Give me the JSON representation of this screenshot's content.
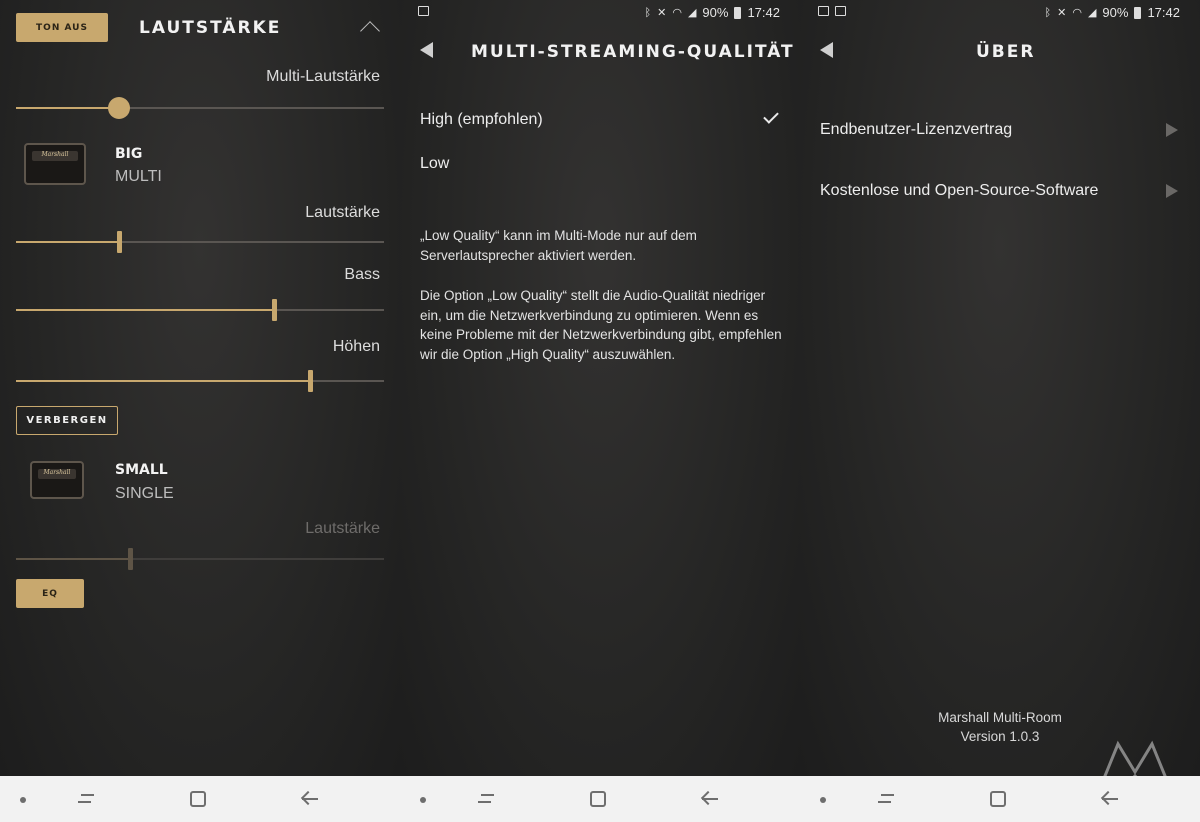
{
  "status_bar": {
    "battery": "90%",
    "time": "17:42"
  },
  "screen1": {
    "mute_button": "TON AUS",
    "title": "LAUTSTÄRKE",
    "multi_volume_label": "Multi-Lautstärke",
    "multi_volume_level": 0.28,
    "speaker_big": {
      "name": "BIG",
      "mode": "MULTI",
      "volume_label": "Lautstärke",
      "volume_level": 0.28,
      "bass_label": "Bass",
      "bass_level": 0.7,
      "treble_label": "Höhen",
      "treble_level": 0.8,
      "hide_button": "VERBERGEN"
    },
    "speaker_small": {
      "name": "SMALL",
      "mode": "SINGLE",
      "volume_label": "Lautstärke",
      "volume_level": 0.31,
      "eq_button": "EQ"
    },
    "logo_text": "Marshall"
  },
  "screen2": {
    "title": "MULTI-STREAMING-QUALITÄT",
    "options": [
      {
        "label": "High (empfohlen)",
        "selected": true
      },
      {
        "label": "Low",
        "selected": false
      }
    ],
    "note1": "„Low Quality“ kann im Multi-Mode nur auf dem Serverlautsprecher aktiviert werden.",
    "note2": "Die Option „Low Quality“ stellt die Audio-Qualität niedriger ein, um die Netzwerkverbindung zu optimieren. Wenn es keine Probleme mit der Netzwerkverbindung gibt, empfehlen wir die Option „High Quality“ auszuwählen."
  },
  "screen3": {
    "title": "ÜBER",
    "items": [
      {
        "label": "Endbenutzer-Lizenzvertrag"
      },
      {
        "label": "Kostenlose und Open-Source-Software"
      }
    ],
    "app_name": "Marshall Multi-Room",
    "version": "Version 1.0.3"
  },
  "colors": {
    "accent": "#c8a86e",
    "background": "#262625",
    "navbar": "#f2f2f2"
  },
  "icons": {
    "status_left_s2": [
      "image-icon"
    ],
    "status_left_s3": [
      "mail-icon",
      "image-icon"
    ],
    "status_right": [
      "bluetooth-icon",
      "mute-icon",
      "wifi-icon",
      "signal-icon",
      "battery-icon"
    ],
    "navbar": [
      "dot-icon",
      "recent-apps-icon",
      "home-icon",
      "back-icon"
    ]
  }
}
